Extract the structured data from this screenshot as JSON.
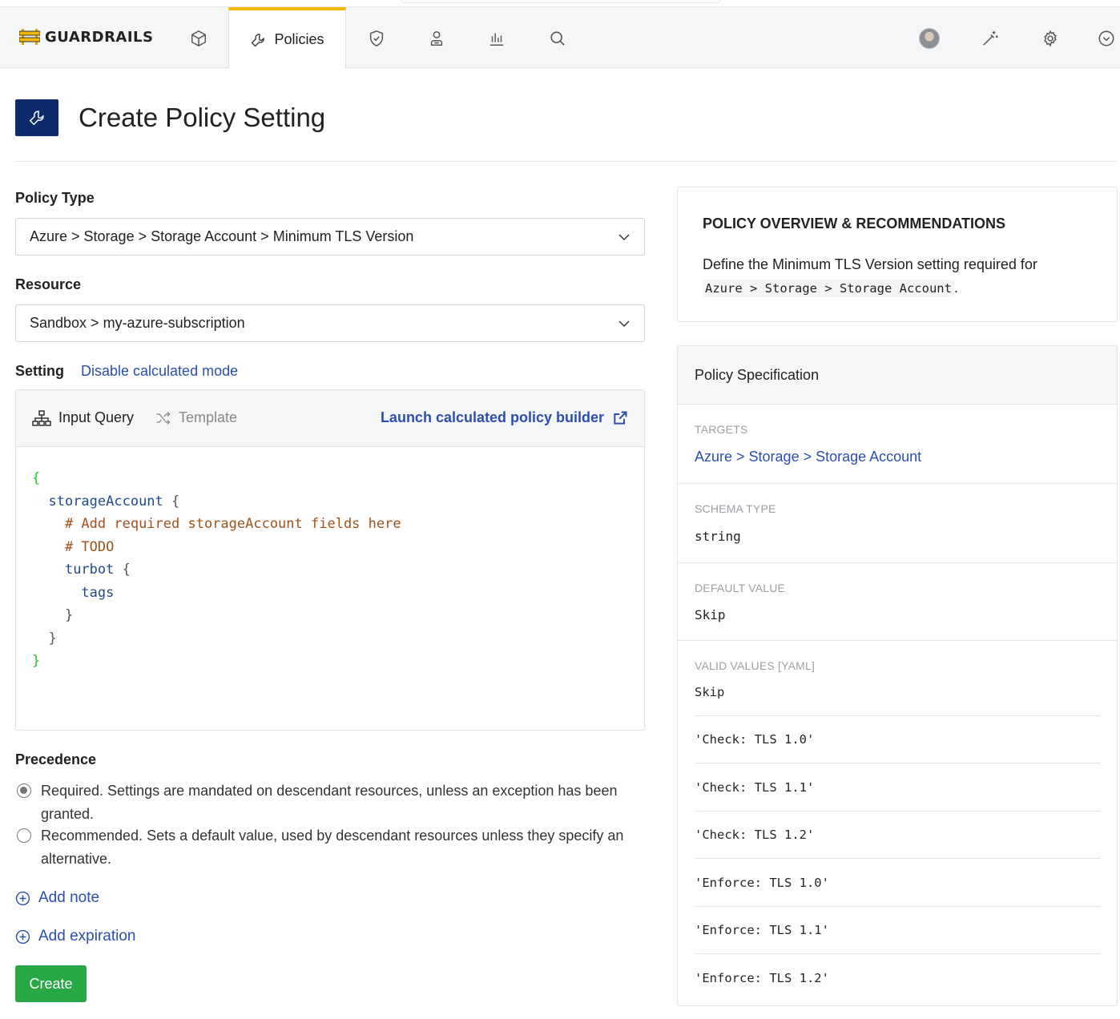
{
  "brand": {
    "name": "GUARDRAILS"
  },
  "nav": {
    "active_tab": "Policies",
    "icons": [
      "cube-icon",
      "wrench-icon",
      "shield-check-icon",
      "user-badge-icon",
      "bar-chart-icon",
      "search-icon",
      "avatar",
      "magic-wand-icon",
      "gear-icon",
      "chevron-circle-down-icon"
    ]
  },
  "page": {
    "title": "Create Policy Setting"
  },
  "form": {
    "policy_type_label": "Policy Type",
    "policy_type_value": "Azure > Storage > Storage Account > Minimum TLS Version",
    "resource_label": "Resource",
    "resource_value": "Sandbox > my-azure-subscription",
    "setting_label": "Setting",
    "disable_calc_link": "Disable calculated mode",
    "tabs": {
      "input_query": "Input Query",
      "template": "Template"
    },
    "builder_link": "Launch calculated policy builder",
    "code": {
      "l1": "{",
      "l2_key": "storageAccount",
      "l2_brace": "{",
      "l3": "# Add required storageAccount fields here",
      "l4": "# TODO",
      "l5_key": "turbot",
      "l5_brace": "{",
      "l6": "tags",
      "l7": "}",
      "l8": "}",
      "l9": "}"
    },
    "precedence_label": "Precedence",
    "precedence_options": [
      {
        "text": "Required. Settings are mandated on descendant resources, unless an exception has been granted.",
        "checked": true
      },
      {
        "text": "Recommended. Sets a default value, used by descendant resources unless they specify an alternative.",
        "checked": false
      }
    ],
    "add_note": "Add note",
    "add_expiration": "Add expiration",
    "create_button": "Create"
  },
  "overview": {
    "title": "POLICY OVERVIEW & RECOMMENDATIONS",
    "text": "Define the Minimum TLS Version setting required for",
    "code": "Azure > Storage > Storage Account",
    "suffix": "."
  },
  "spec": {
    "title": "Policy Specification",
    "targets_label": "TARGETS",
    "targets_value": "Azure > Storage > Storage Account",
    "schema_label": "SCHEMA TYPE",
    "schema_value": "string",
    "default_label": "DEFAULT VALUE",
    "default_value": "Skip",
    "valid_label": "VALID VALUES [YAML]",
    "valid_values": [
      "Skip",
      "'Check: TLS 1.0'",
      "'Check: TLS 1.1'",
      "'Check: TLS 1.2'",
      "'Enforce: TLS 1.0'",
      "'Enforce: TLS 1.1'",
      "'Enforce: TLS 1.2'"
    ]
  },
  "colors": {
    "accent": "#2b4eb0",
    "tab_indicator": "#f5b800",
    "header_badge": "#0d2a6b",
    "create": "#28a745"
  }
}
